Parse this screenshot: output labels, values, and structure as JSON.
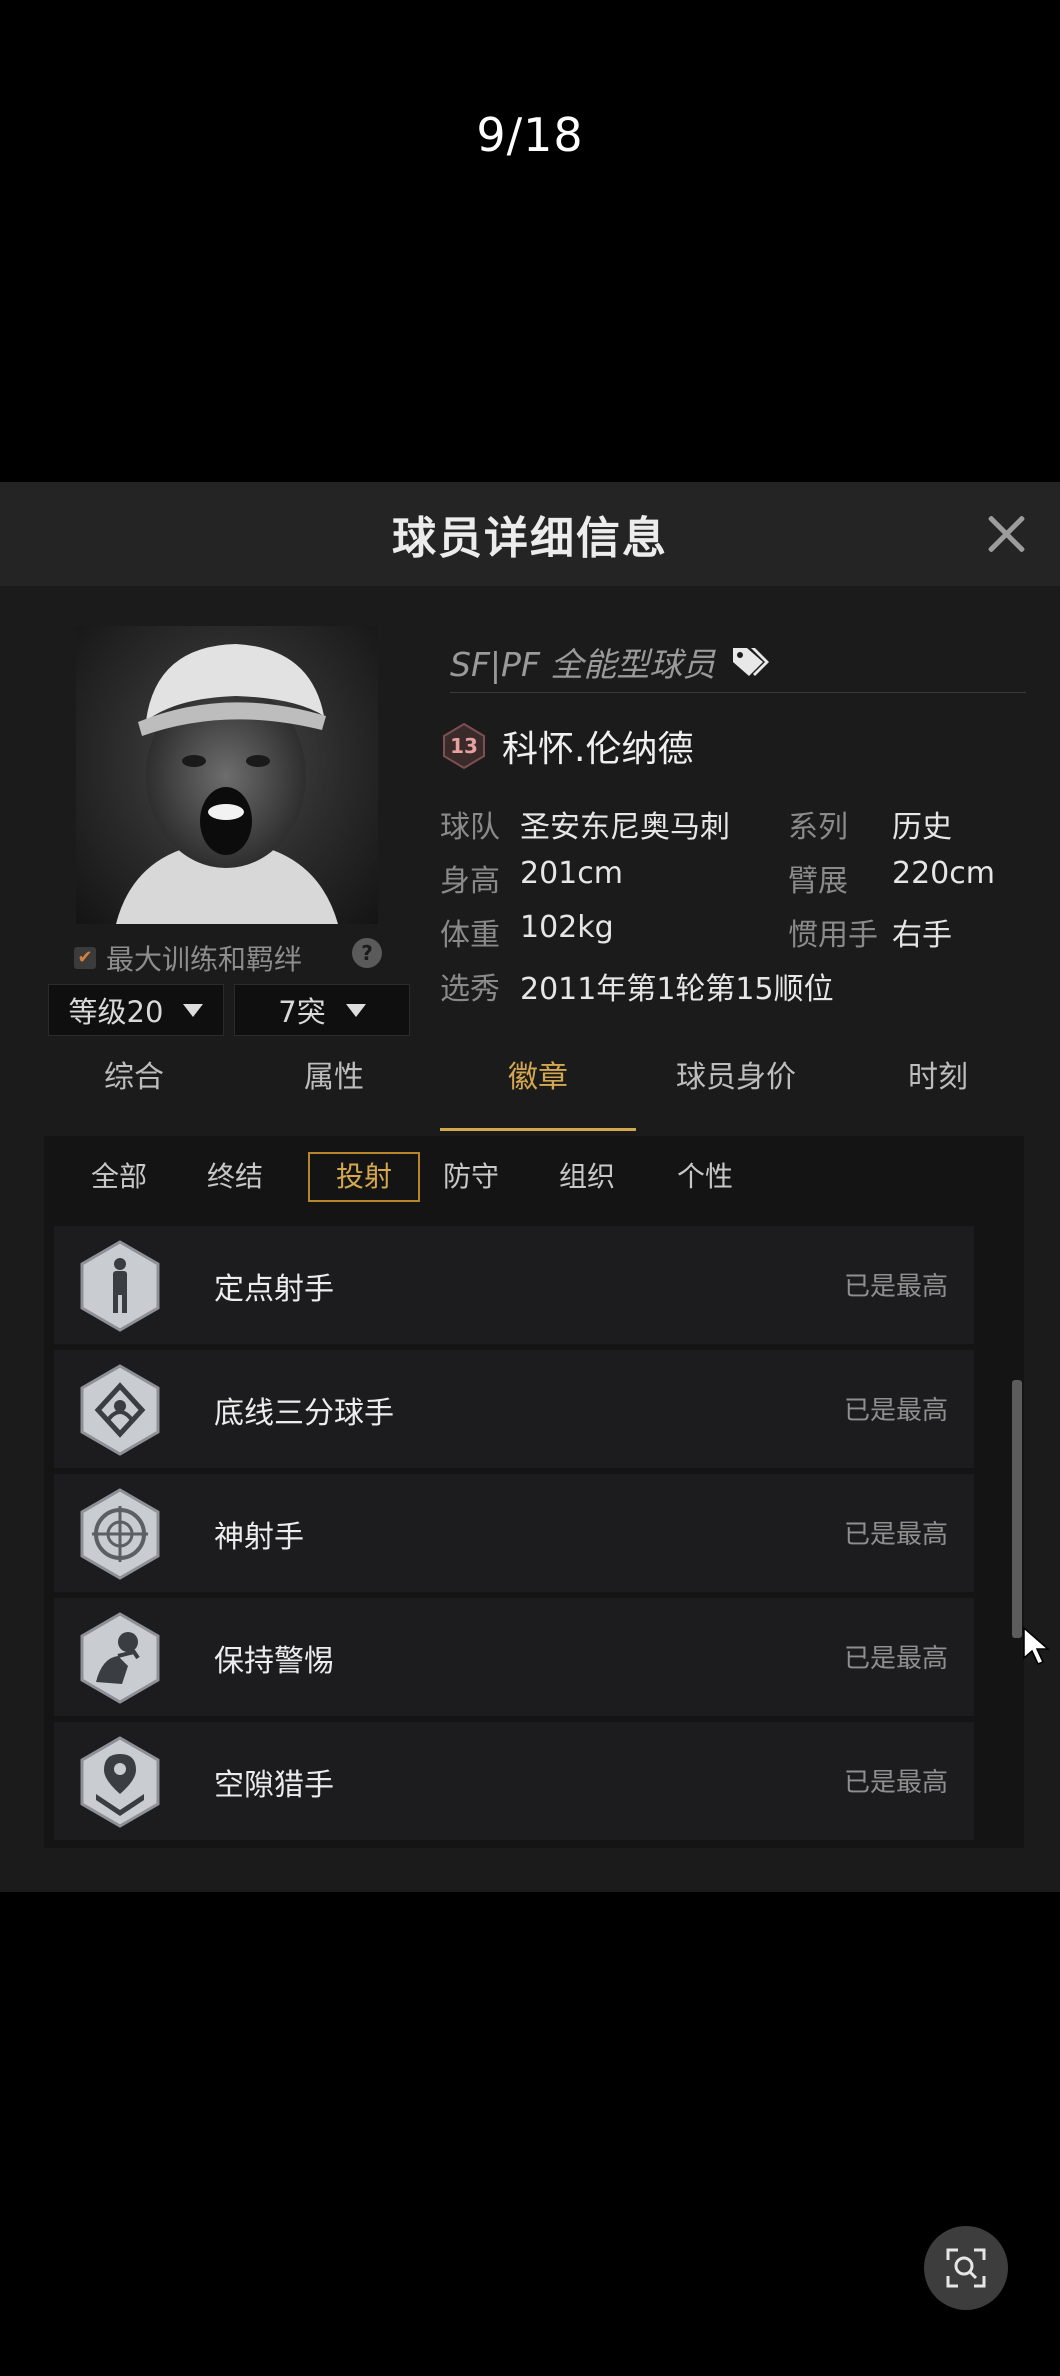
{
  "page_counter": "9/18",
  "dialog": {
    "title": "球员详细信息"
  },
  "player": {
    "role": "SF|PF 全能型球员",
    "jersey_number": "13",
    "name": "科怀.伦纳德",
    "bond_label": "最大训练和羁绊",
    "level_selector": "等级20",
    "break_selector": "7突",
    "info": [
      {
        "label": "球队",
        "value": "圣安东尼奥马刺",
        "label2": "系列",
        "value2": "历史"
      },
      {
        "label": "身高",
        "value": "201cm",
        "label2": "臂展",
        "value2": "220cm"
      },
      {
        "label": "体重",
        "value": "102kg",
        "label2": "惯用手",
        "value2": "右手"
      },
      {
        "label": "选秀",
        "value": "2011年第1轮第15顺位",
        "label2": "",
        "value2": ""
      }
    ]
  },
  "tabs": [
    "综合",
    "属性",
    "徽章",
    "球员身价",
    "时刻"
  ],
  "active_tab": "徽章",
  "subtabs": [
    "全部",
    "终结",
    "投射",
    "防守",
    "组织",
    "个性"
  ],
  "active_subtab": "投射",
  "badges": [
    {
      "name": "定点射手",
      "status": "已是最高",
      "icon": "standing-player-icon"
    },
    {
      "name": "底线三分球手",
      "status": "已是最高",
      "icon": "corner-court-icon"
    },
    {
      "name": "神射手",
      "status": "已是最高",
      "icon": "crosshair-icon"
    },
    {
      "name": "保持警惕",
      "status": "已是最高",
      "icon": "ball-handler-icon"
    },
    {
      "name": "空隙猎手",
      "status": "已是最高",
      "icon": "location-pin-icon"
    }
  ],
  "colors": {
    "accent": "#d4a84e",
    "background": "#000000",
    "panel": "#1b1b1c"
  }
}
